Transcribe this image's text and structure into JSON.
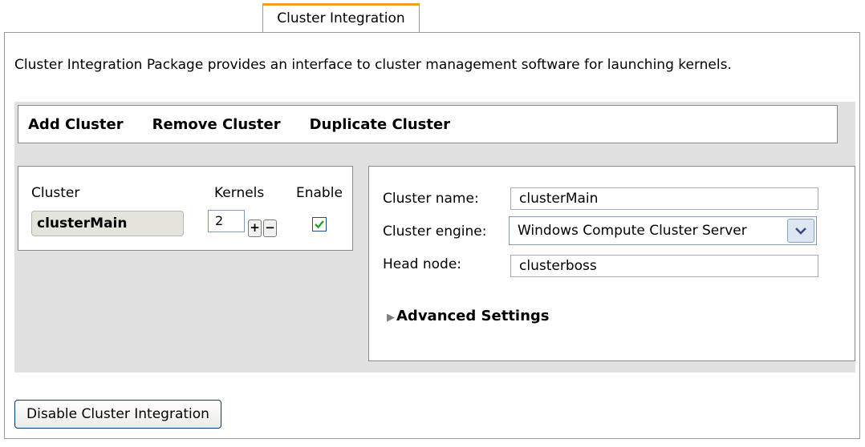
{
  "tab": {
    "label": "Cluster Integration"
  },
  "description": "Cluster Integration Package provides an interface to cluster management software for launching kernels.",
  "toolbar": {
    "add_label": "Add Cluster",
    "remove_label": "Remove Cluster",
    "duplicate_label": "Duplicate Cluster"
  },
  "cluster_list": {
    "headers": {
      "cluster": "Cluster",
      "kernels": "Kernels",
      "enable": "Enable"
    },
    "rows": [
      {
        "name": "clusterMain",
        "kernels": "2",
        "enabled": true
      }
    ],
    "plus_label": "+",
    "minus_label": "−"
  },
  "details": {
    "name_label": "Cluster name:",
    "name_value": "clusterMain",
    "engine_label": "Cluster engine:",
    "engine_value": "Windows Compute Cluster Server",
    "head_label": "Head node:",
    "head_value": "clusterboss",
    "advanced_label": "Advanced Settings"
  },
  "footer": {
    "disable_label": "Disable Cluster Integration"
  },
  "colors": {
    "tab_accent": "#f0a020",
    "checkmark": "#21a121",
    "panel_gray": "#e1e1e1"
  }
}
